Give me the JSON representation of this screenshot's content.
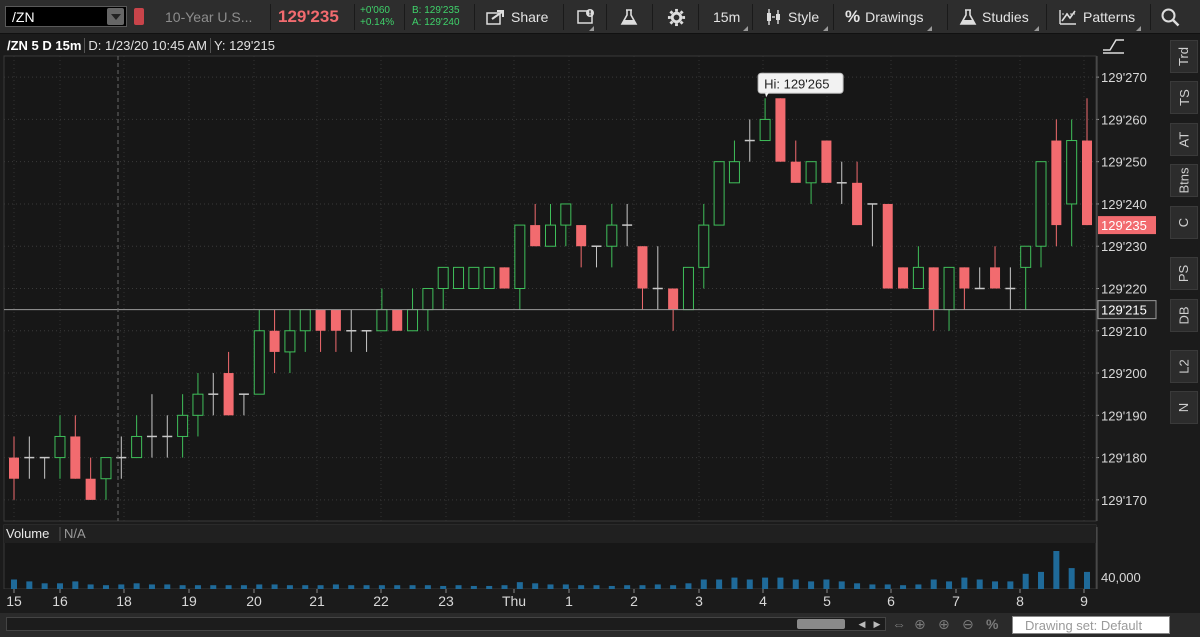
{
  "toolbar": {
    "symbol": "/ZN",
    "description": "10-Year U.S...",
    "last_price": "129'235",
    "net_change": "+0'060",
    "pct_change": "+0.14%",
    "bid": "B: 129'235",
    "ask": "A: 129'240",
    "share_label": "Share",
    "timeframe_label": "15m",
    "style_label": "Style",
    "drawings_label": "Drawings",
    "studies_label": "Studies",
    "patterns_label": "Patterns",
    "icons": [
      "share-icon",
      "alert-icon",
      "flask-icon",
      "gear-icon",
      "candle-icon",
      "percent-icon",
      "flask-icon",
      "patterns-icon",
      "search-icon"
    ]
  },
  "chart_header": {
    "title": "/ZN 5 D 15m",
    "datetime": "D: 1/23/20 10:45 AM",
    "y_value": "Y: 129'215"
  },
  "price_axis": {
    "ticks": [
      "129'270",
      "129'260",
      "129'250",
      "129'240",
      "129'230",
      "129'220",
      "129'210",
      "129'200",
      "129'190",
      "129'180",
      "129'170"
    ],
    "last_price_label": "129'235",
    "cursor_price_label": "129'215"
  },
  "high_label": "Hi: 129'265",
  "volume_panel": {
    "title": "Volume",
    "value": "N/A",
    "axis_label": "40,000"
  },
  "time_axis": {
    "labels": [
      "15",
      "16",
      "18",
      "19",
      "20",
      "21",
      "22",
      "23",
      "Thu",
      "1",
      "2",
      "3",
      "4",
      "5",
      "6",
      "7",
      "8",
      "9"
    ]
  },
  "right_tabs": [
    "Trd",
    "TS",
    "AT",
    "Btns",
    "C",
    "PS",
    "DB",
    "L2",
    "N"
  ],
  "bottom": {
    "drawing_set": "Drawing set: Default"
  },
  "chart_data": {
    "type": "candlestick",
    "instrument": "/ZN",
    "interval": "15m",
    "price_axis_range": [
      129.165,
      129.275
    ],
    "up_color": "#3fbf5a",
    "down_color": "#f26b6f",
    "doji_color": "#c8c8c8",
    "high": 129.265,
    "cursor_price": 129.215,
    "last_price": 129.235,
    "candles_ohlc": [
      [
        129.18,
        129.185,
        129.17,
        129.175
      ],
      [
        129.18,
        129.185,
        129.175,
        129.18
      ],
      [
        129.18,
        129.18,
        129.175,
        129.18
      ],
      [
        129.18,
        129.19,
        129.175,
        129.185
      ],
      [
        129.185,
        129.19,
        129.175,
        129.175
      ],
      [
        129.175,
        129.18,
        129.17,
        129.17
      ],
      [
        129.175,
        129.18,
        129.17,
        129.18
      ],
      [
        129.18,
        129.185,
        129.175,
        129.18
      ],
      [
        129.18,
        129.19,
        129.18,
        129.185
      ],
      [
        129.185,
        129.195,
        129.18,
        129.185
      ],
      [
        129.185,
        129.19,
        129.18,
        129.185
      ],
      [
        129.185,
        129.195,
        129.18,
        129.19
      ],
      [
        129.19,
        129.2,
        129.185,
        129.195
      ],
      [
        129.195,
        129.2,
        129.19,
        129.195
      ],
      [
        129.2,
        129.205,
        129.19,
        129.19
      ],
      [
        129.195,
        129.195,
        129.19,
        129.195
      ],
      [
        129.195,
        129.215,
        129.195,
        129.21
      ],
      [
        129.21,
        129.215,
        129.2,
        129.205
      ],
      [
        129.205,
        129.215,
        129.2,
        129.21
      ],
      [
        129.21,
        129.215,
        129.205,
        129.215
      ],
      [
        129.215,
        129.215,
        129.205,
        129.21
      ],
      [
        129.215,
        129.215,
        129.205,
        129.21
      ],
      [
        129.21,
        129.215,
        129.205,
        129.21
      ],
      [
        129.21,
        129.21,
        129.205,
        129.21
      ],
      [
        129.21,
        129.22,
        129.21,
        129.215
      ],
      [
        129.215,
        129.215,
        129.21,
        129.21
      ],
      [
        129.21,
        129.22,
        129.21,
        129.215
      ],
      [
        129.215,
        129.22,
        129.21,
        129.22
      ],
      [
        129.22,
        129.225,
        129.215,
        129.225
      ],
      [
        129.22,
        129.225,
        129.22,
        129.225
      ],
      [
        129.22,
        129.225,
        129.22,
        129.225
      ],
      [
        129.22,
        129.225,
        129.22,
        129.225
      ],
      [
        129.225,
        129.225,
        129.22,
        129.22
      ],
      [
        129.22,
        129.235,
        129.215,
        129.235
      ],
      [
        129.235,
        129.24,
        129.23,
        129.23
      ],
      [
        129.23,
        129.24,
        129.23,
        129.235
      ],
      [
        129.235,
        129.24,
        129.23,
        129.24
      ],
      [
        129.235,
        129.235,
        129.225,
        129.23
      ],
      [
        129.23,
        129.23,
        129.225,
        129.23
      ],
      [
        129.23,
        129.24,
        129.225,
        129.235
      ],
      [
        129.235,
        129.24,
        129.23,
        129.235
      ],
      [
        129.23,
        129.23,
        129.215,
        129.22
      ],
      [
        129.22,
        129.23,
        129.215,
        129.22
      ],
      [
        129.22,
        129.22,
        129.21,
        129.215
      ],
      [
        129.215,
        129.225,
        129.215,
        129.225
      ],
      [
        129.225,
        129.24,
        129.22,
        129.235
      ],
      [
        129.235,
        129.25,
        129.235,
        129.25
      ],
      [
        129.245,
        129.255,
        129.245,
        129.25
      ],
      [
        129.255,
        129.26,
        129.25,
        129.255
      ],
      [
        129.255,
        129.265,
        129.255,
        129.26
      ],
      [
        129.265,
        129.265,
        129.25,
        129.25
      ],
      [
        129.25,
        129.255,
        129.245,
        129.245
      ],
      [
        129.245,
        129.25,
        129.24,
        129.25
      ],
      [
        129.255,
        129.255,
        129.245,
        129.245
      ],
      [
        129.245,
        129.25,
        129.24,
        129.245
      ],
      [
        129.245,
        129.25,
        129.235,
        129.235
      ],
      [
        129.24,
        129.24,
        129.23,
        129.24
      ],
      [
        129.24,
        129.24,
        129.22,
        129.22
      ],
      [
        129.225,
        129.225,
        129.22,
        129.22
      ],
      [
        129.22,
        129.23,
        129.22,
        129.225
      ],
      [
        129.225,
        129.225,
        129.21,
        129.215
      ],
      [
        129.215,
        129.225,
        129.21,
        129.225
      ],
      [
        129.225,
        129.225,
        129.215,
        129.22
      ],
      [
        129.22,
        129.225,
        129.22,
        129.22
      ],
      [
        129.225,
        129.23,
        129.22,
        129.22
      ],
      [
        129.22,
        129.225,
        129.215,
        129.22
      ],
      [
        129.225,
        129.23,
        129.215,
        129.23
      ],
      [
        129.23,
        129.24,
        129.225,
        129.25
      ],
      [
        129.255,
        129.26,
        129.23,
        129.235
      ],
      [
        129.24,
        129.26,
        129.23,
        129.255
      ],
      [
        129.255,
        129.265,
        129.235,
        129.235
      ]
    ],
    "volume_relative": [
      0.25,
      0.2,
      0.15,
      0.15,
      0.2,
      0.12,
      0.1,
      0.12,
      0.15,
      0.12,
      0.12,
      0.1,
      0.1,
      0.1,
      0.1,
      0.1,
      0.12,
      0.12,
      0.1,
      0.1,
      0.1,
      0.12,
      0.1,
      0.1,
      0.1,
      0.1,
      0.1,
      0.1,
      0.08,
      0.1,
      0.08,
      0.08,
      0.1,
      0.18,
      0.15,
      0.12,
      0.12,
      0.1,
      0.1,
      0.08,
      0.1,
      0.1,
      0.12,
      0.1,
      0.15,
      0.25,
      0.25,
      0.3,
      0.25,
      0.3,
      0.3,
      0.25,
      0.2,
      0.25,
      0.2,
      0.15,
      0.12,
      0.12,
      0.1,
      0.12,
      0.25,
      0.2,
      0.3,
      0.25,
      0.2,
      0.2,
      0.4,
      0.45,
      1.0,
      0.55,
      0.45
    ]
  }
}
